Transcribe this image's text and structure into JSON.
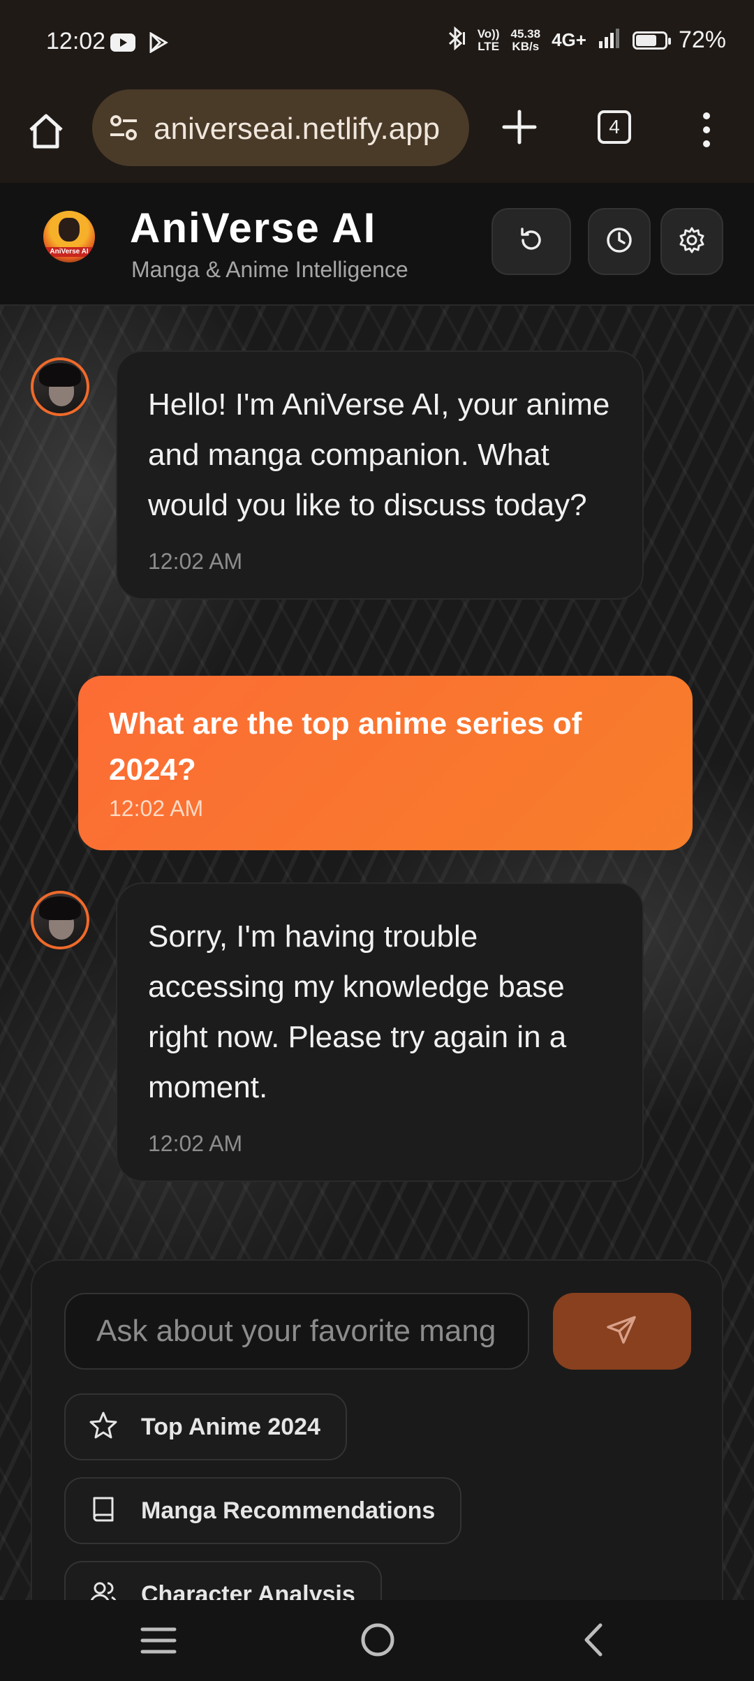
{
  "status_bar": {
    "time": "12:02",
    "notification_icons": [
      "youtube-icon",
      "play-store-icon"
    ],
    "network_speed_value": "45.38",
    "network_speed_unit": "KB/s",
    "volte_label_1": "Vo))",
    "volte_label_2": "LTE",
    "network_type": "4G+",
    "battery_percent": "72%",
    "battery_level": 0.72
  },
  "browser": {
    "url": "aniverseai.netlify.app",
    "tab_count": "4"
  },
  "app": {
    "title": "AniVerse AI",
    "subtitle": "Manga & Anime Intelligence",
    "logo_text": "AniVerse AI",
    "accent_color": "#f97b32"
  },
  "messages": [
    {
      "role": "bot",
      "text": "Hello! I'm AniVerse AI, your anime and manga companion. What would you like to discuss today?",
      "time": "12:02 AM"
    },
    {
      "role": "user",
      "text": "What are the top anime series of 2024?",
      "time": "12:02 AM"
    },
    {
      "role": "bot",
      "text": "Sorry, I'm having trouble accessing my knowledge base right now. Please try again in a moment.",
      "time": "12:02 AM"
    }
  ],
  "composer": {
    "placeholder": "Ask about your favorite manga or anime...",
    "suggestions": [
      {
        "label": "Top Anime 2024",
        "icon": "star-icon"
      },
      {
        "label": "Manga Recommendations",
        "icon": "book-icon"
      },
      {
        "label": "Character Analysis",
        "icon": "users-icon"
      }
    ]
  }
}
